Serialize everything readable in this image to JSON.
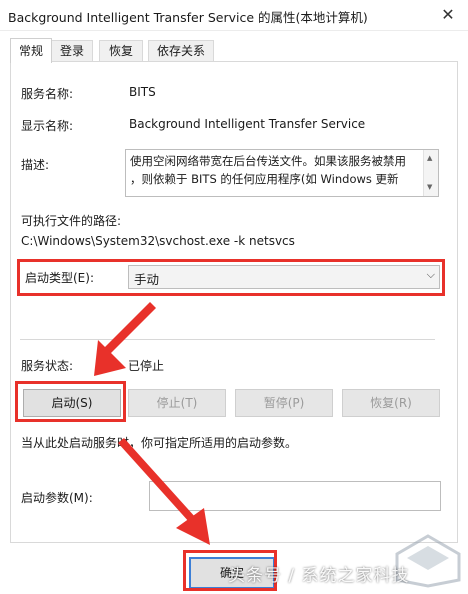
{
  "window": {
    "title": "Background Intelligent Transfer Service 的属性(本地计算机)",
    "close_glyph": "✕"
  },
  "tabs": [
    {
      "label": "常规",
      "active": true
    },
    {
      "label": "登录",
      "active": false
    },
    {
      "label": "恢复",
      "active": false
    },
    {
      "label": "依存关系",
      "active": false
    }
  ],
  "general": {
    "service_name_label": "服务名称:",
    "service_name_value": "BITS",
    "display_name_label": "显示名称:",
    "display_name_value": "Background Intelligent Transfer Service",
    "description_label": "描述:",
    "description_lines": [
      "使用空闲网络带宽在后台传送文件。如果该服务被禁用",
      "，则依赖于 BITS 的任何应用程序(如 Windows 更新"
    ],
    "exe_path_label": "可执行文件的路径:",
    "exe_path_value": "C:\\Windows\\System32\\svchost.exe -k netsvcs",
    "startup_type_label": "启动类型(E):",
    "startup_type_value": "手动",
    "status_label": "服务状态:",
    "status_value": "已停止"
  },
  "buttons": {
    "start": "启动(S)",
    "stop": "停止(T)",
    "pause": "暂停(P)",
    "resume": "恢复(R)"
  },
  "hint_text": "当从此处启动服务时，你可指定所适用的启动参数。",
  "start_params_label": "启动参数(M):",
  "start_params_value": "",
  "ok_button": "确定",
  "watermark_text": "头条号 / 系统之家科技",
  "colors": {
    "highlight_red": "#e8312a",
    "focus_blue": "#3c7fd6"
  }
}
